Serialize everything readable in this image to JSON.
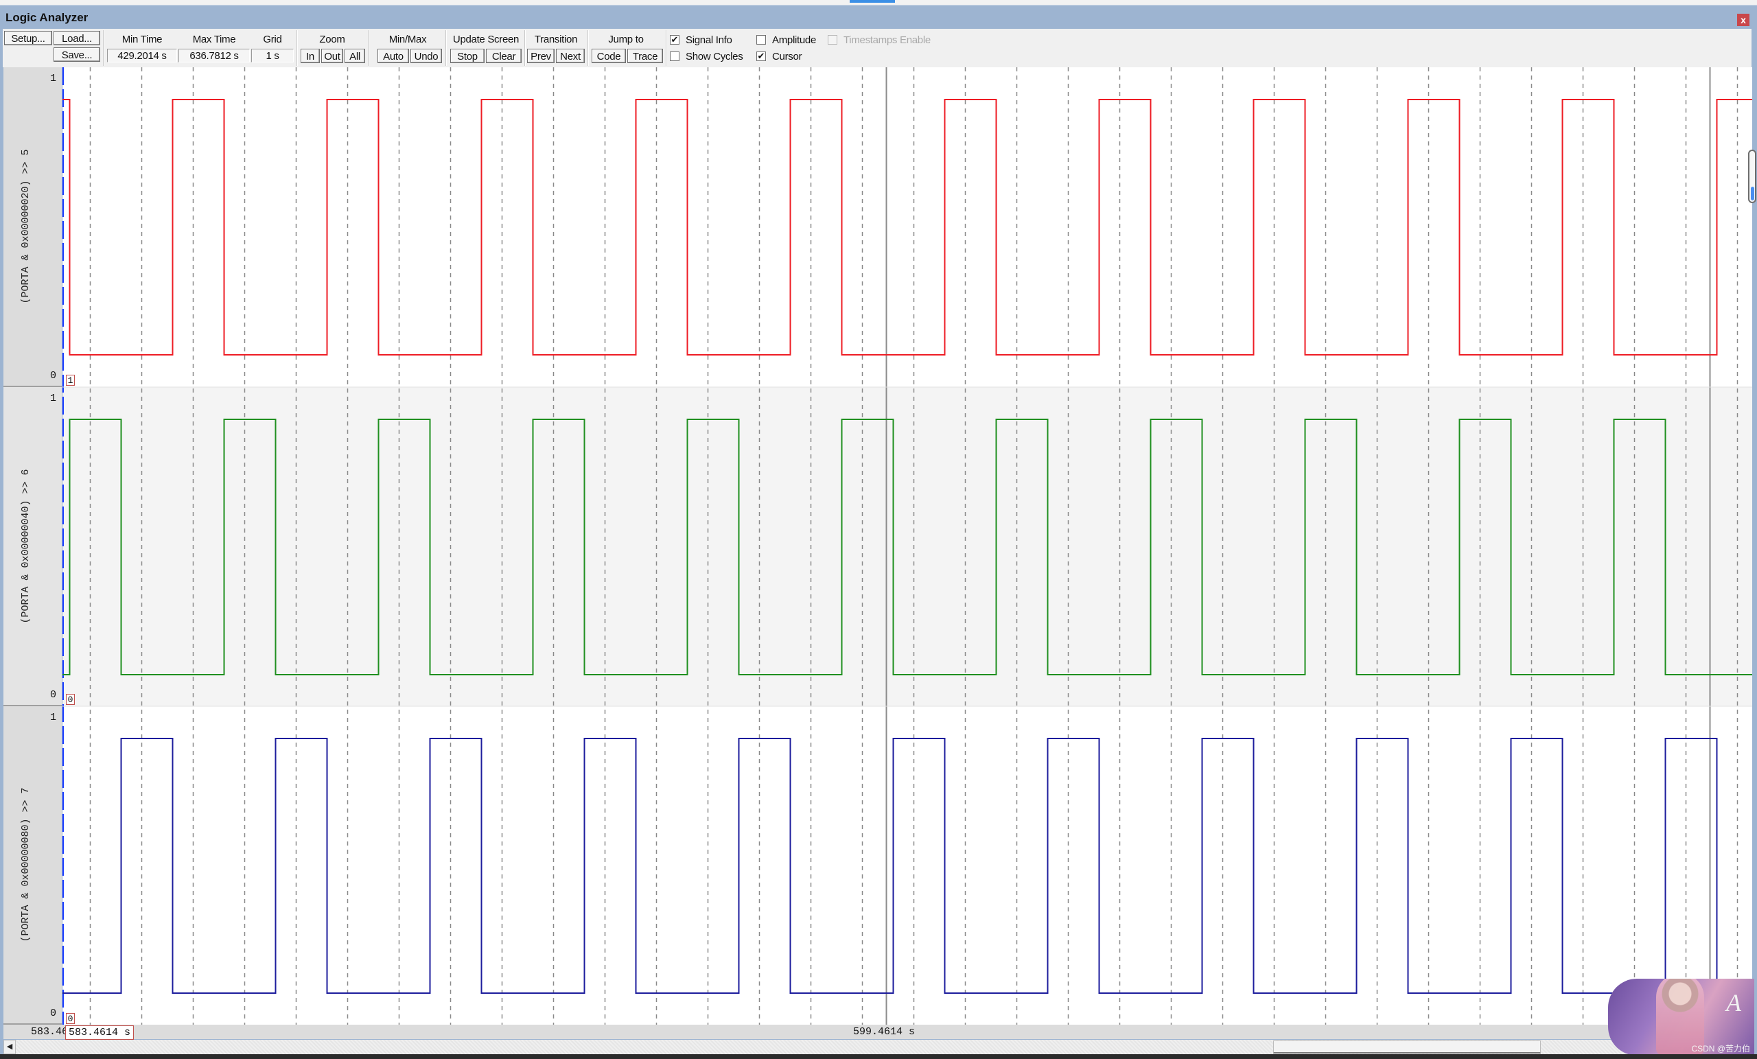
{
  "window": {
    "title": "Logic Analyzer",
    "close_label": "x"
  },
  "toolbar": {
    "setup_label": "Setup...",
    "load_label": "Load...",
    "save_label": "Save...",
    "min_time_label": "Min Time",
    "min_time_value": "429.2014 s",
    "max_time_label": "Max Time",
    "max_time_value": "636.7812 s",
    "grid_label": "Grid",
    "grid_value": "1 s",
    "zoom_label": "Zoom",
    "zoom_in": "In",
    "zoom_out": "Out",
    "zoom_all": "All",
    "minmax_label": "Min/Max",
    "minmax_auto": "Auto",
    "minmax_undo": "Undo",
    "update_label": "Update Screen",
    "update_stop": "Stop",
    "update_clear": "Clear",
    "transition_label": "Transition",
    "transition_prev": "Prev",
    "transition_next": "Next",
    "jump_label": "Jump to",
    "jump_code": "Code",
    "jump_trace": "Trace",
    "checkboxes": {
      "signal_info": {
        "label": "Signal Info",
        "checked": true
      },
      "amplitude": {
        "label": "Amplitude",
        "checked": false
      },
      "timestamps_enable": {
        "label": "Timestamps Enable",
        "checked": false,
        "disabled": true
      },
      "show_cycles": {
        "label": "Show Cycles",
        "checked": false
      },
      "cursor": {
        "label": "Cursor",
        "checked": true
      }
    }
  },
  "timeline": {
    "left_time_label": "583.46",
    "cursor_time_label": "583.4614 s",
    "mid_time_label": "599.4614 s"
  },
  "watermark": {
    "letter": "A",
    "text": "CSDN @苦力伯"
  },
  "chart_data": {
    "type": "line",
    "subtype": "logic-analyzer-step",
    "x_unit": "s",
    "xlim": [
      583.4614,
      616.2947
    ],
    "grid_step": 1,
    "grid": true,
    "cursor_lines": [
      599.4614,
      615.4614
    ],
    "view_start_cursor": 583.4614,
    "series": [
      {
        "name": "(PORTA & 0x00000020) >> 5",
        "color": "#ee1c24",
        "ylim": [
          0,
          1
        ],
        "ytick_top": "1",
        "ytick_bottom": "0",
        "value_at_cursor": "1",
        "initial_value": 1,
        "transitions": [
          583.595,
          585.595,
          586.595,
          588.595,
          589.595,
          591.595,
          592.595,
          594.595,
          595.595,
          597.595,
          598.595,
          600.595,
          601.595,
          603.595,
          604.595,
          606.595,
          607.595,
          609.595,
          610.595,
          612.595,
          613.595,
          615.595
        ]
      },
      {
        "name": "(PORTA & 0x00000040) >> 6",
        "color": "#1f8f1f",
        "ylim": [
          0,
          1
        ],
        "ytick_top": "1",
        "ytick_bottom": "0",
        "value_at_cursor": "0",
        "initial_value": 0,
        "transitions": [
          583.595,
          584.595,
          586.595,
          587.595,
          589.595,
          590.595,
          592.595,
          593.595,
          595.595,
          596.595,
          598.595,
          599.595,
          601.595,
          602.595,
          604.595,
          605.595,
          607.595,
          608.595,
          610.595,
          611.595,
          613.595,
          614.595
        ]
      },
      {
        "name": "(PORTA & 0x00000080) >> 7",
        "color": "#1c1c9c",
        "ylim": [
          0,
          1
        ],
        "ytick_top": "1",
        "ytick_bottom": "0",
        "value_at_cursor": "0",
        "initial_value": 0,
        "transitions": [
          584.595,
          585.595,
          587.595,
          588.595,
          590.595,
          591.595,
          593.595,
          594.595,
          596.595,
          597.595,
          599.595,
          600.595,
          602.595,
          603.595,
          605.595,
          606.595,
          608.595,
          609.595,
          611.595,
          612.595,
          614.595,
          615.595
        ]
      }
    ]
  }
}
